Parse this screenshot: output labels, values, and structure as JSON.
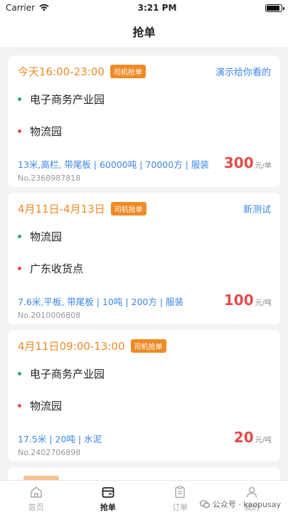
{
  "status": {
    "carrier": "Carrier",
    "time": "3:21 PM"
  },
  "nav": {
    "title": "抢单"
  },
  "orders": [
    {
      "time": "今天16:00-23:00",
      "tag": "司机抢单",
      "title": "演示给你看的",
      "from": "电子商务产业园",
      "to": "物流园",
      "specs": "13米,高栏, 带尾板 | 60000吨 | 70000方 | 服装",
      "order_no": "No.2368987818",
      "price": "300",
      "price_unit": "元/单"
    },
    {
      "time": "4月11日-4月13日",
      "tag": "司机抢单",
      "title": "新测试",
      "from": "物流园",
      "to": "广东收货点",
      "specs": "7.6米,平板, 带尾板 | 10吨 | 200方 | 服装",
      "order_no": "No.2010006808",
      "price": "100",
      "price_unit": "元/吨"
    },
    {
      "time": "4月11日09:00-13:00",
      "tag": "司机抢单",
      "title": "",
      "from": "电子商务产业园",
      "to": "物流园",
      "specs": "17.5米 | 20吨 | 水泥",
      "order_no": "No.2402706898",
      "price": "20",
      "price_unit": "元/吨"
    }
  ],
  "tabs": [
    {
      "label": "首页",
      "icon": "home-icon"
    },
    {
      "label": "抢单",
      "icon": "wallet-icon"
    },
    {
      "label": "订单",
      "icon": "clipboard-icon"
    },
    {
      "label": "我的",
      "icon": "user-icon"
    }
  ],
  "watermark": {
    "text": "公众号 · kaopusay"
  },
  "colors": {
    "accent": "#f08a24",
    "link": "#3a86e8",
    "price": "#e24b4b"
  }
}
